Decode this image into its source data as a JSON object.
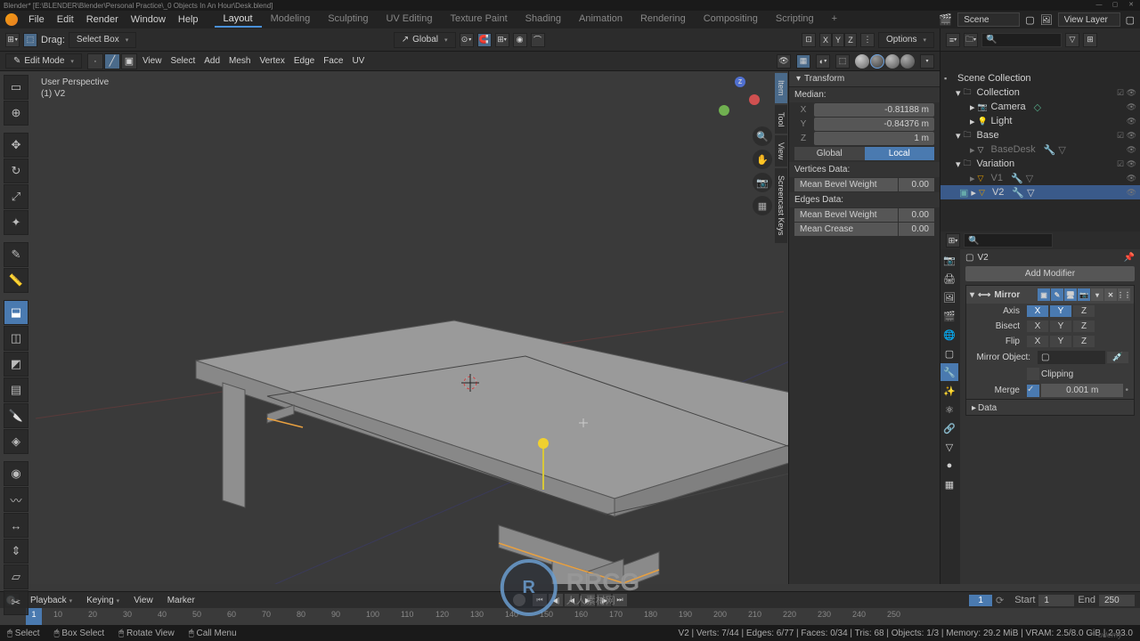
{
  "titlebar": "Blender* [E:\\BLENDER\\Blender\\Personal Practice\\_0 Objects In An Hour\\Desk.blend]",
  "top_menu": {
    "items": [
      "File",
      "Edit",
      "Render",
      "Window",
      "Help"
    ]
  },
  "workspaces": {
    "tabs": [
      "Layout",
      "Modeling",
      "Sculpting",
      "UV Editing",
      "Texture Paint",
      "Shading",
      "Animation",
      "Rendering",
      "Compositing",
      "Scripting"
    ],
    "active": 0
  },
  "scene": {
    "label": "Scene",
    "layer": "View Layer"
  },
  "view_header": {
    "drag": "Drag:",
    "select_box": "Select Box",
    "global": "Global",
    "options": "Options"
  },
  "edit_header": {
    "mode": "Edit Mode",
    "menus": [
      "View",
      "Select",
      "Add",
      "Mesh",
      "Vertex",
      "Edge",
      "Face",
      "UV"
    ]
  },
  "viewport": {
    "line1": "User Perspective",
    "line2": "(1) V2"
  },
  "n_panel": {
    "title": "Transform",
    "median": "Median:",
    "x": "-0.81188 m",
    "y": "-0.84376 m",
    "z": "1 m",
    "global": "Global",
    "local": "Local",
    "vertices_data": "Vertices Data:",
    "mean_bevel_weight": "Mean Bevel Weight",
    "mbw_v_val": "0.00",
    "edges_data": "Edges Data:",
    "mbw_e_val": "0.00",
    "mean_crease": "Mean Crease",
    "mc_val": "0.00",
    "tabs": [
      "Item",
      "Tool",
      "View",
      "Screencast Keys"
    ]
  },
  "outliner": {
    "scene_collection": "Scene Collection",
    "collection": "Collection",
    "camera": "Camera",
    "light": "Light",
    "base": "Base",
    "basedesk": "BaseDesk",
    "variation": "Variation",
    "v1": "V1",
    "v2": "V2"
  },
  "properties": {
    "breadcrumb": "V2",
    "add_modifier": "Add Modifier",
    "modifier_name": "Mirror",
    "axis_label": "Axis",
    "bisect_label": "Bisect",
    "flip_label": "Flip",
    "mirror_object": "Mirror Object:",
    "clipping": "Clipping",
    "merge": "Merge",
    "merge_val": "0.001 m",
    "data": "Data"
  },
  "timeline": {
    "menus": [
      "Playback",
      "Keying",
      "View",
      "Marker"
    ],
    "current": "1",
    "start_label": "Start",
    "start": "1",
    "end_label": "End",
    "end": "250",
    "ticks": [
      "10",
      "20",
      "30",
      "40",
      "50",
      "60",
      "70",
      "80",
      "90",
      "100",
      "110",
      "120",
      "130",
      "140",
      "150",
      "160",
      "170",
      "180",
      "190",
      "200",
      "210",
      "220",
      "230",
      "240",
      "250"
    ]
  },
  "status": {
    "select": "Select",
    "box_select": "Box Select",
    "rotate_view": "Rotate View",
    "call_menu": "Call Menu",
    "right": "V2 | Verts: 7/44 | Edges: 6/77 | Faces: 0/34 | Tris: 68 | Objects: 1/3 | Memory: 29.2 MiB | VRAM: 2.5/8.0 GiB | 2.93.0"
  },
  "watermark": {
    "logo": "R",
    "main": "RRCG",
    "sub": "人人素材网"
  },
  "udemy": "udemy"
}
